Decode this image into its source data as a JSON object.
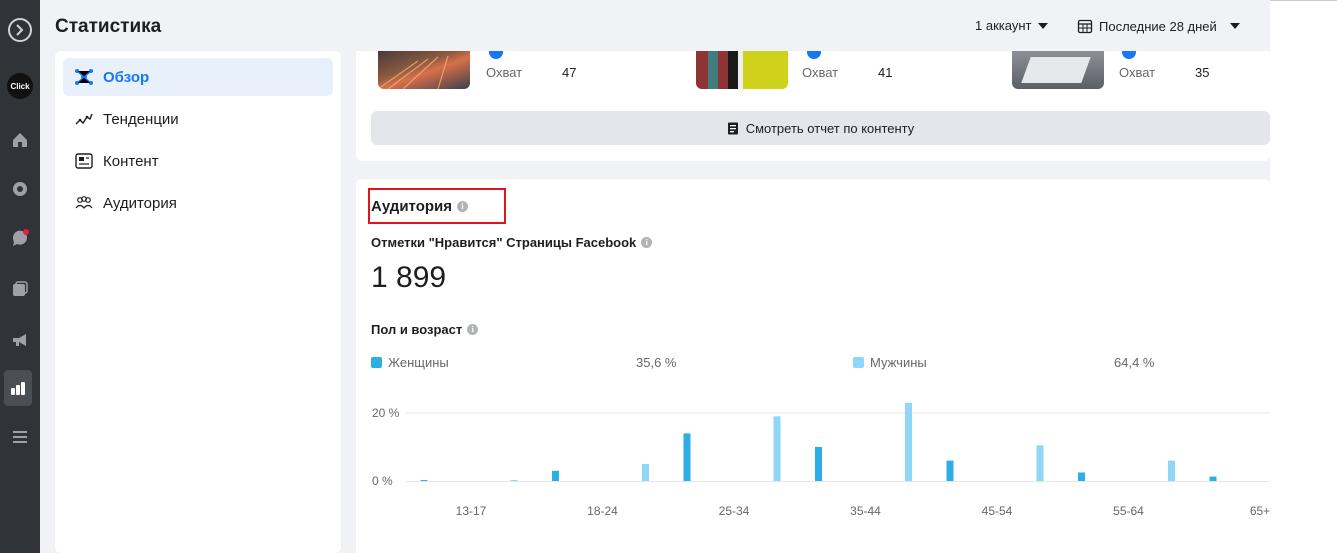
{
  "header": {
    "title": "Статистика",
    "account_label": "1 аккаунт",
    "period_label": "Последние 28 дней"
  },
  "rail_icons": [
    "logo-icon",
    "click-avatar",
    "home-icon",
    "chat-icon",
    "messages-icon",
    "pages-icon",
    "megaphone-icon",
    "insights-icon",
    "menu-icon"
  ],
  "rail_avatar_text": "Click",
  "sidebar": {
    "items": [
      {
        "label": "Обзор",
        "icon": "overview-icon",
        "active": true
      },
      {
        "label": "Тенденции",
        "icon": "trends-icon",
        "active": false
      },
      {
        "label": "Контент",
        "icon": "content-icon",
        "active": false
      },
      {
        "label": "Аудитория",
        "icon": "audience-icon",
        "active": false
      }
    ]
  },
  "content": {
    "posts": [
      {
        "metric_label": "Охват",
        "metric_value": "47"
      },
      {
        "metric_label": "Охват",
        "metric_value": "41"
      },
      {
        "metric_label": "Охват",
        "metric_value": "35"
      }
    ],
    "report_button": "Смотреть отчет по контенту"
  },
  "audience": {
    "title": "Аудитория",
    "likes_label": "Отметки \"Нравится\" Страницы Facebook",
    "likes_value": "1 899",
    "gender_age_label": "Пол и возраст",
    "legend": [
      {
        "name": "Женщины",
        "percent": "35,6 %",
        "color": "#2eaee6"
      },
      {
        "name": "Мужчины",
        "percent": "64,4 %",
        "color": "#8fd6f7"
      }
    ]
  },
  "colors": {
    "accent": "#1877f2",
    "women": "#2eaee6",
    "men": "#8fd6f7",
    "highlight_box": "#e0141e"
  },
  "chart_data": {
    "type": "bar",
    "categories": [
      "13-17",
      "18-24",
      "25-34",
      "35-44",
      "45-54",
      "55-64",
      "65+"
    ],
    "series": [
      {
        "name": "Женщины",
        "values": [
          0,
          3,
          14,
          10,
          6,
          2.5,
          1.3
        ]
      },
      {
        "name": "Мужчины",
        "values": [
          0.3,
          5,
          19,
          23,
          10.5,
          6,
          0
        ]
      }
    ],
    "ytick_labels": [
      "0 %",
      "20 %"
    ],
    "ylim": [
      0,
      20
    ]
  }
}
